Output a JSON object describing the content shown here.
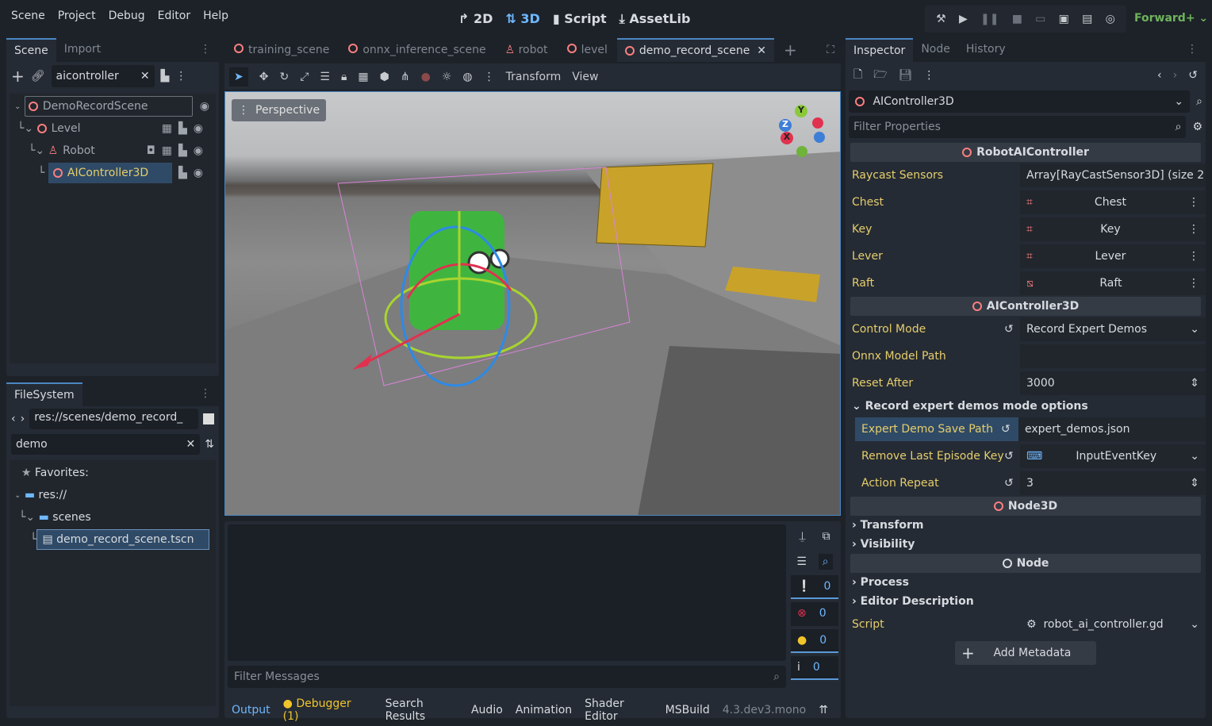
{
  "menu": [
    "Scene",
    "Project",
    "Debug",
    "Editor",
    "Help"
  ],
  "modes": {
    "2d": "2D",
    "3d": "3D",
    "script": "Script",
    "assetlib": "AssetLib"
  },
  "renderer": "Forward+",
  "scene_dock": {
    "tabs": [
      "Scene",
      "Import"
    ],
    "filter_value": "aicontroller",
    "tree": [
      {
        "label": "DemoRecordScene",
        "icon": "node3d-icon"
      },
      {
        "label": "Level",
        "icon": "node3d-icon"
      },
      {
        "label": "Robot",
        "icon": "character-icon"
      },
      {
        "label": "AIController3D",
        "icon": "node3d-icon",
        "selected": true
      }
    ]
  },
  "filesystem": {
    "tab": "FileSystem",
    "path": "res://scenes/demo_record_",
    "filter_value": "demo",
    "items": [
      {
        "label": "Favorites:"
      },
      {
        "label": "res://"
      },
      {
        "label": "scenes"
      },
      {
        "label": "demo_record_scene.tscn",
        "selected": true
      }
    ]
  },
  "scene_tabs": [
    "training_scene",
    "onnx_inference_scene",
    "robot",
    "level",
    "demo_record_scene"
  ],
  "active_scene_tab": "demo_record_scene",
  "toolbar": {
    "transform": "Transform",
    "view": "View"
  },
  "viewport": {
    "perspective_label": "Perspective",
    "gizmo": {
      "x": "X",
      "y": "Y",
      "z": "Z"
    }
  },
  "bottom": {
    "filter_placeholder": "Filter Messages",
    "counts": [
      "0",
      "0",
      "0",
      "0"
    ],
    "tabs": [
      "Output",
      "Debugger (1)",
      "Search Results",
      "Audio",
      "Animation",
      "Shader Editor",
      "MSBuild"
    ],
    "version": "4.3.dev3.mono"
  },
  "inspector": {
    "tabs": [
      "Inspector",
      "Node",
      "History"
    ],
    "node_name": "AIController3D",
    "filter_placeholder": "Filter Properties",
    "sections": {
      "robot": "RobotAIController",
      "ai": "AIController3D",
      "node3d": "Node3D",
      "node": "Node"
    },
    "raycast": {
      "label": "Raycast Sensors",
      "value": "Array[RayCastSensor3D] (size 2"
    },
    "paths": [
      {
        "label": "Chest",
        "value": "Chest"
      },
      {
        "label": "Key",
        "value": "Key"
      },
      {
        "label": "Lever",
        "value": "Lever"
      },
      {
        "label": "Raft",
        "value": "Raft"
      }
    ],
    "control_mode": {
      "label": "Control Mode",
      "value": "Record Expert Demos"
    },
    "onnx": {
      "label": "Onnx Model Path",
      "value": ""
    },
    "reset_after": {
      "label": "Reset After",
      "value": "3000"
    },
    "record_group": "Record expert demos mode options",
    "save_path": {
      "label": "Expert Demo Save Path",
      "value": "expert_demos.json"
    },
    "remove_key": {
      "label": "Remove Last Episode Key",
      "value": "InputEventKey"
    },
    "action_repeat": {
      "label": "Action Repeat",
      "value": "3"
    },
    "groups": [
      "Transform",
      "Visibility",
      "Process",
      "Editor Description"
    ],
    "script": {
      "label": "Script",
      "value": "robot_ai_controller.gd"
    },
    "add_metadata": "Add Metadata"
  },
  "colors": {
    "accent": "#4a86c2",
    "node3d": "#fc7f7f",
    "property": "#e5cd6c",
    "renderer": "#6fb35c"
  }
}
